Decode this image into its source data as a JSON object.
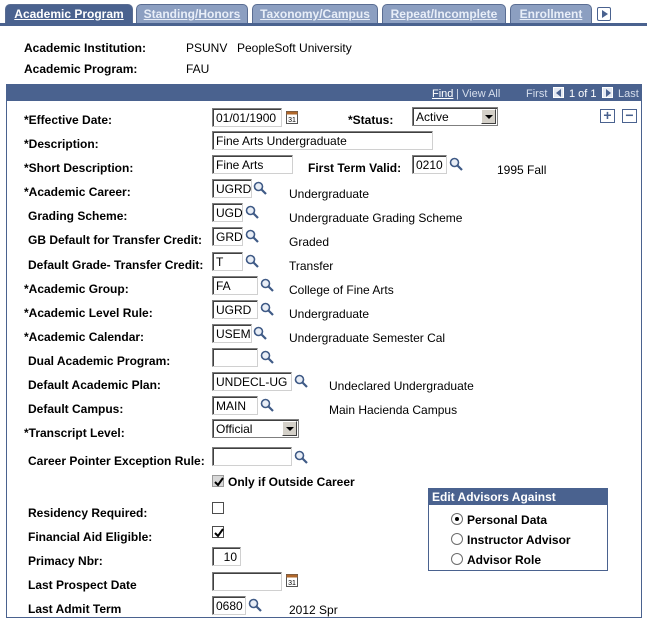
{
  "tabs": [
    {
      "label": "Academic Program",
      "active": true
    },
    {
      "label": "Standing/Honors",
      "active": false
    },
    {
      "label": "Taxonomy/Campus",
      "active": false
    },
    {
      "label": "Repeat/Incomplete",
      "active": false
    },
    {
      "label": "Enrollment",
      "active": false
    }
  ],
  "header": {
    "institution_label": "Academic Institution:",
    "institution_code": "PSUNV",
    "institution_name": "PeopleSoft University",
    "program_label": "Academic Program:",
    "program_code": "FAU"
  },
  "grid_nav": {
    "find": "Find",
    "view_all": "View All",
    "first": "First",
    "range": "1 of 1",
    "last": "Last"
  },
  "buttons": {
    "add": "+",
    "delete": "−"
  },
  "form": {
    "effective_date": {
      "label": "*Effective Date:",
      "value": "01/01/1900"
    },
    "status": {
      "label": "*Status:",
      "value": "Active"
    },
    "description": {
      "label": "*Description:",
      "value": "Fine Arts Undergraduate"
    },
    "short_description": {
      "label": "*Short Description:",
      "value": "Fine Arts"
    },
    "first_term_valid": {
      "label": "First Term Valid:",
      "value": "0210",
      "desc": "1995 Fall"
    },
    "academic_career": {
      "label": "*Academic Career:",
      "value": "UGRD",
      "desc": "Undergraduate"
    },
    "grading_scheme": {
      "label": "Grading Scheme:",
      "value": "UGD",
      "desc": "Undergraduate Grading Scheme"
    },
    "gb_default": {
      "label": "GB Default for Transfer Credit:",
      "value": "GRD",
      "desc": "Graded"
    },
    "default_grade": {
      "label": "Default Grade- Transfer Credit:",
      "value": "T",
      "desc": "Transfer"
    },
    "academic_group": {
      "label": "*Academic Group:",
      "value": "FA",
      "desc": "College of Fine Arts"
    },
    "academic_level_rule": {
      "label": "*Academic Level Rule:",
      "value": "UGRD",
      "desc": "Undergraduate"
    },
    "academic_calendar": {
      "label": "*Academic Calendar:",
      "value": "USEM",
      "desc": "Undergraduate Semester Cal"
    },
    "dual_program": {
      "label": "Dual Academic Program:",
      "value": ""
    },
    "default_plan": {
      "label": "Default Academic Plan:",
      "value": "UNDECL-UG",
      "desc": "Undeclared Undergraduate"
    },
    "default_campus": {
      "label": "Default Campus:",
      "value": "MAIN",
      "desc": "Main Hacienda Campus"
    },
    "transcript_level": {
      "label": "*Transcript Level:",
      "value": "Official"
    },
    "career_pointer": {
      "label": "Career Pointer Exception Rule:",
      "value": ""
    },
    "only_outside": {
      "label": "Only if Outside Career",
      "checked": true
    },
    "residency": {
      "label": "Residency Required:",
      "checked": false
    },
    "financial_aid": {
      "label": "Financial Aid Eligible:",
      "checked": true
    },
    "primacy": {
      "label": "Primacy Nbr:",
      "value": "10"
    },
    "last_prospect": {
      "label": "Last Prospect Date",
      "value": ""
    },
    "last_admit": {
      "label": "Last Admit Term",
      "value": "0680",
      "desc": "2012 Spr"
    }
  },
  "advisors": {
    "title": "Edit Advisors Against",
    "options": [
      {
        "label": "Personal Data",
        "selected": true
      },
      {
        "label": "Instructor Advisor",
        "selected": false
      },
      {
        "label": "Advisor Role",
        "selected": false
      }
    ]
  },
  "colors": {
    "accent": "#4a628f",
    "tab_inactive": "#8c9fc1"
  }
}
